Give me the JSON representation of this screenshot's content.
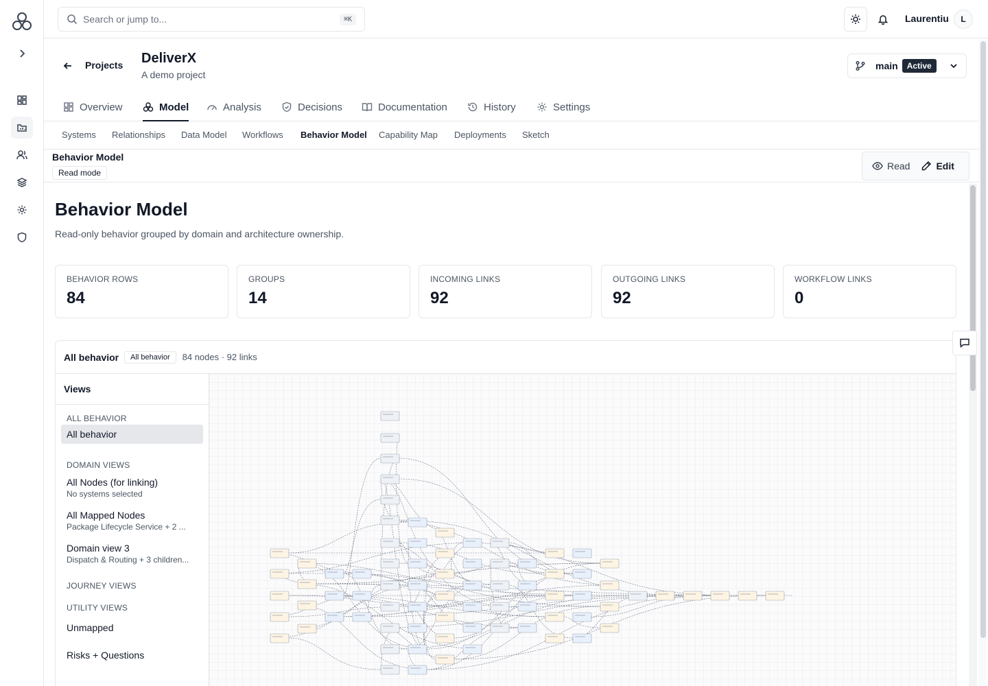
{
  "search": {
    "placeholder": "Search or jump to...",
    "shortcut": "⌘K"
  },
  "user": {
    "name": "Laurentiu",
    "initial": "L"
  },
  "project": {
    "back_label": "Projects",
    "title": "DeliverX",
    "subtitle": "A demo project"
  },
  "branch": {
    "name": "main",
    "status": "Active"
  },
  "tabs": [
    {
      "label": "Overview",
      "icon": "grid-icon"
    },
    {
      "label": "Model",
      "icon": "model-icon",
      "active": true
    },
    {
      "label": "Analysis",
      "icon": "gauge-icon"
    },
    {
      "label": "Decisions",
      "icon": "shield-check-icon"
    },
    {
      "label": "Documentation",
      "icon": "book-icon"
    },
    {
      "label": "History",
      "icon": "history-icon"
    },
    {
      "label": "Settings",
      "icon": "gear-icon"
    }
  ],
  "subtabs": [
    "Systems",
    "Relationships",
    "Data Model",
    "Workflows",
    "Behavior Model",
    "Capability Map",
    "Deployments",
    "Sketch"
  ],
  "mode": {
    "title": "Behavior Model",
    "badge": "Read mode",
    "read_label": "Read",
    "edit_label": "Edit"
  },
  "page": {
    "title": "Behavior Model",
    "description": "Read-only behavior grouped by domain and architecture ownership."
  },
  "stats": [
    {
      "label": "BEHAVIOR ROWS",
      "value": "84"
    },
    {
      "label": "GROUPS",
      "value": "14"
    },
    {
      "label": "INCOMING LINKS",
      "value": "92"
    },
    {
      "label": "OUTGOING LINKS",
      "value": "92"
    },
    {
      "label": "WORKFLOW LINKS",
      "value": "0"
    }
  ],
  "panel": {
    "title": "All behavior",
    "badge": "All behavior",
    "meta": "84 nodes · 92 links"
  },
  "views": {
    "header": "Views",
    "sections": {
      "all": "ALL BEHAVIOR",
      "domain": "DOMAIN VIEWS",
      "journey": "JOURNEY VIEWS",
      "utility": "UTILITY VIEWS"
    },
    "all_behavior": "All behavior",
    "domain_views": [
      {
        "label": "All Nodes (for linking)",
        "sub": "No systems selected"
      },
      {
        "label": "All Mapped Nodes",
        "sub": "Package Lifecycle Service + 2 ..."
      },
      {
        "label": "Domain view 3",
        "sub": "Dispatch & Routing + 3 children..."
      }
    ],
    "utility_views": [
      "Unmapped",
      "Risks + Questions"
    ]
  },
  "colors": {
    "accent": "#111827",
    "badge_bg": "#1f2937",
    "border": "#e5e7eb",
    "muted": "#4b5563"
  }
}
